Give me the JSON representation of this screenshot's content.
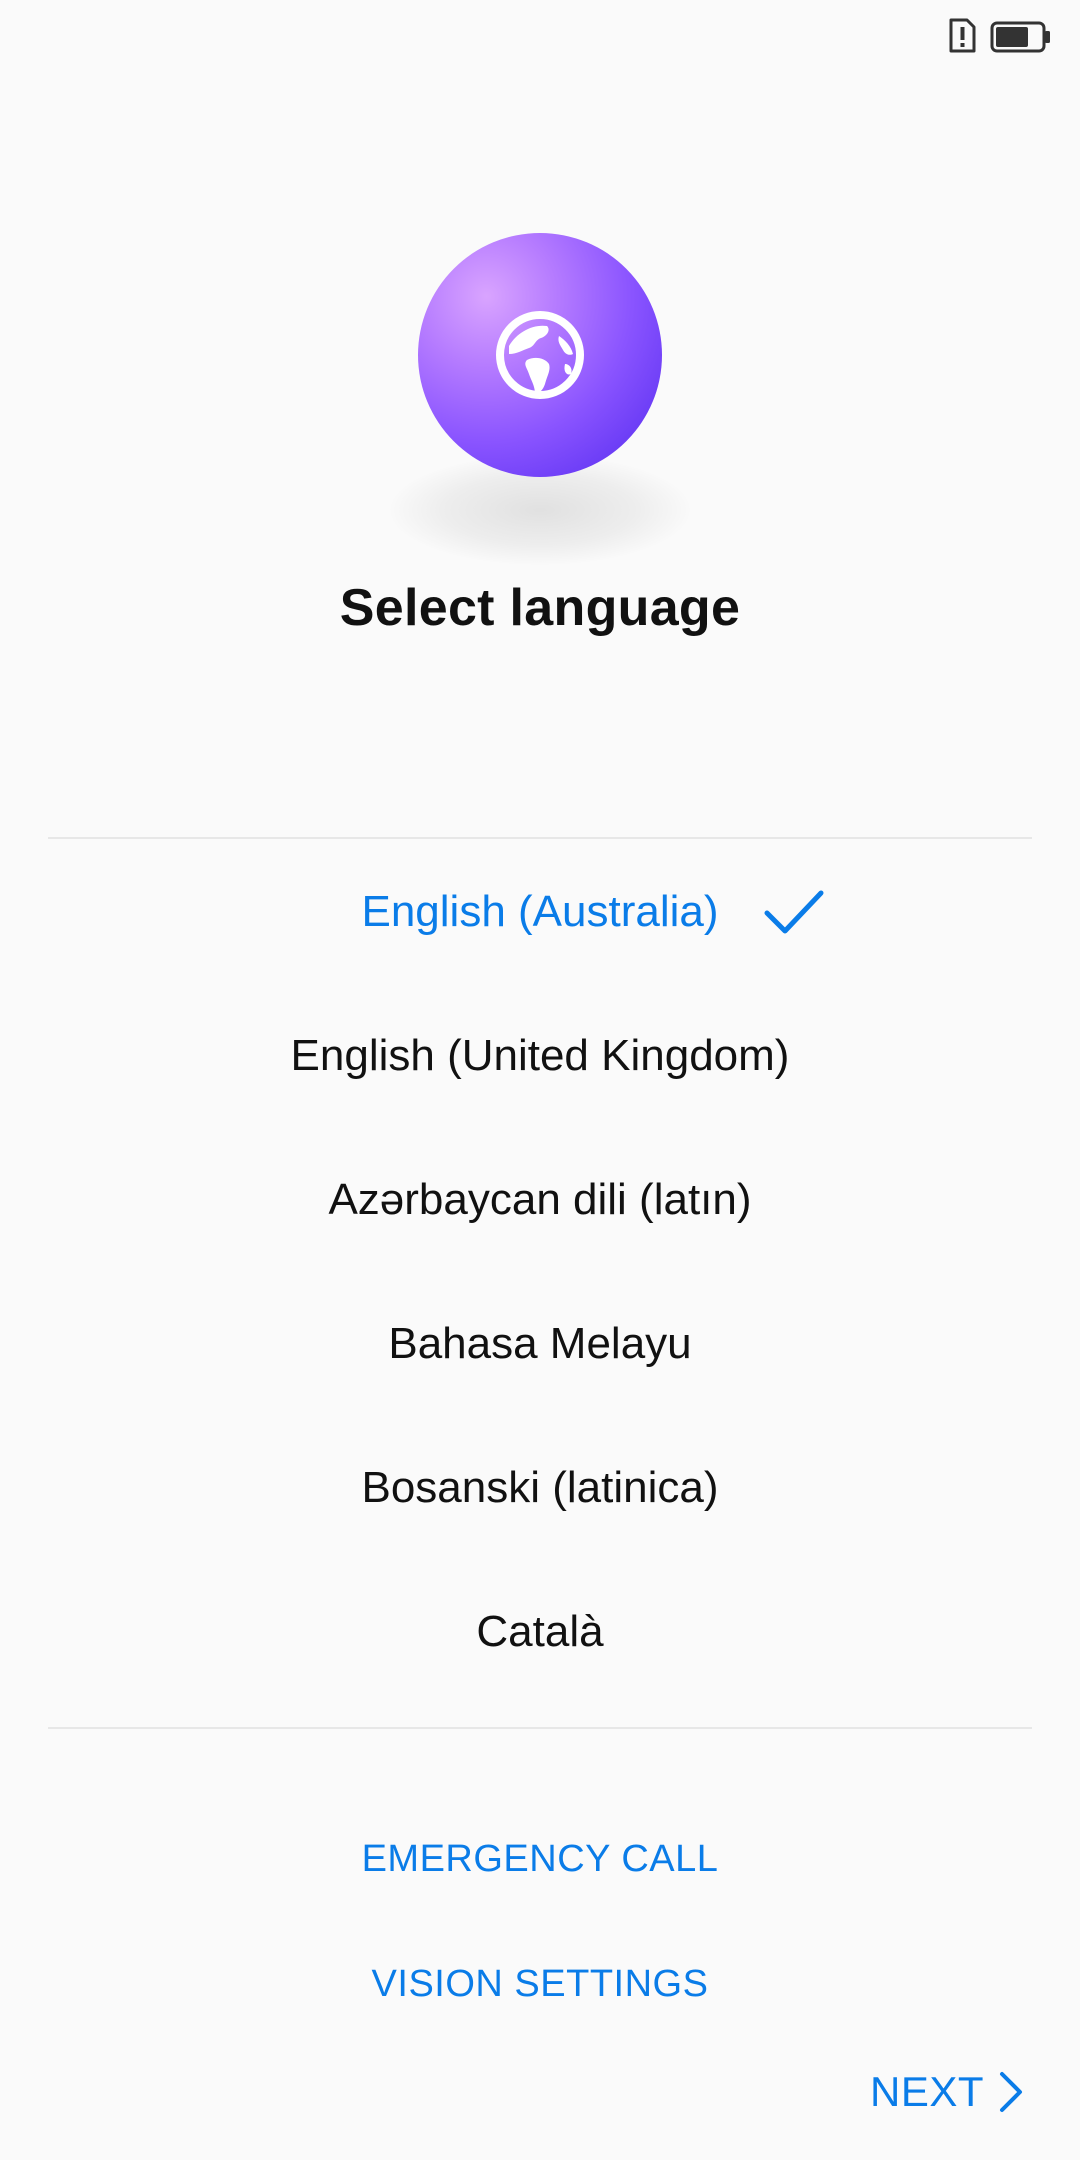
{
  "status_bar": {
    "sim_icon": "sim-card-alert-icon",
    "battery_icon": "battery-icon"
  },
  "hero": {
    "globe_icon": "globe-icon",
    "title": "Select language"
  },
  "languages": {
    "items": [
      {
        "label": "English (Australia)",
        "selected": true
      },
      {
        "label": "English (United Kingdom)",
        "selected": false
      },
      {
        "label": "Azərbaycan dili (latın)",
        "selected": false
      },
      {
        "label": "Bahasa Melayu",
        "selected": false
      },
      {
        "label": "Bosanski (latinica)",
        "selected": false
      },
      {
        "label": "Català",
        "selected": false
      }
    ],
    "selected_icon": "checkmark-icon"
  },
  "actions": {
    "emergency_call": "EMERGENCY CALL",
    "vision_settings": "VISION SETTINGS",
    "next": "NEXT",
    "next_icon": "chevron-right-icon"
  },
  "colors": {
    "accent": "#0a7ce8",
    "globe_light": "#d9a4ff",
    "globe_dark": "#6c3df6",
    "background": "#fafafa",
    "text": "#111111"
  }
}
